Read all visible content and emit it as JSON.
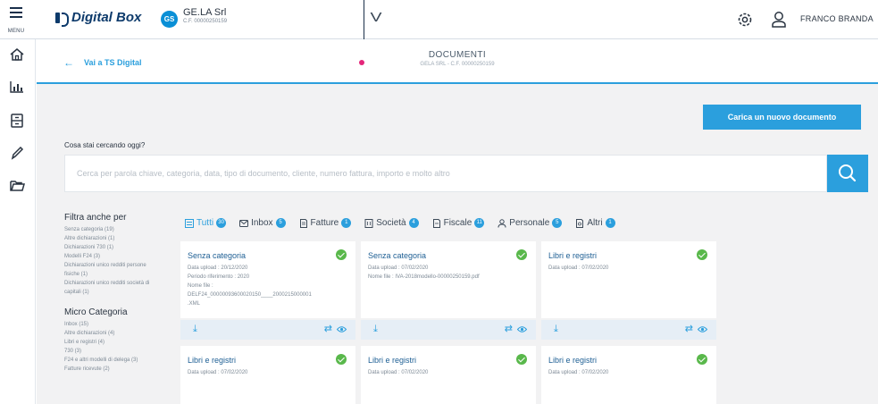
{
  "topbar": {
    "menu_label": "MENU",
    "logo_text": "Digital Box",
    "company_initials": "GS",
    "company_name": "GE.LA Srl",
    "company_cf": "C.F. 00000250159",
    "chevron": "V",
    "user_name": "FRANCO BRANDA"
  },
  "rail": {
    "items": [
      "home-icon",
      "chart-icon",
      "archive-icon",
      "pen-icon",
      "folder-icon"
    ]
  },
  "subheader": {
    "back_label": "Vai a TS Digital",
    "title": "DOCUMENTI",
    "subtitle": "GELA SRL - C.F. 00000250159"
  },
  "upload_button": "Carica un nuovo documento",
  "search": {
    "label": "Cosa stai cercando oggi?",
    "placeholder": "Cerca per parola chiave, categoria, data, tipo di documento, cliente, numero fattura, importo e molto altro",
    "value": ""
  },
  "filters": {
    "title": "Filtra anche per",
    "items": [
      "Senza categoria (19)",
      "Altre dichiarazioni (1)",
      "Dichiarazioni 730 (1)",
      "Modelli F24 (3)",
      "Dichiarazioni unico redditi persone",
      "fisiche (1)",
      "Dichiarazioni unico redditi società di",
      "capitali (1)"
    ],
    "micro_title": "Micro Categoria",
    "micro_items": [
      "Inbox (15)",
      "Altre dichiarazioni (4)",
      "Libri e registri (4)",
      "730 (3)",
      "F24 e altri modelli di delega (3)",
      "Fatture ricevute (2)"
    ]
  },
  "tabs": [
    {
      "label": "Tutti",
      "count": "30"
    },
    {
      "label": "Inbox",
      "count": "5"
    },
    {
      "label": "Fatture",
      "count": "1"
    },
    {
      "label": "Società",
      "count": "4"
    },
    {
      "label": "Fiscale",
      "count": "11"
    },
    {
      "label": "Personale",
      "count": "5"
    },
    {
      "label": "Altri",
      "count": "1"
    }
  ],
  "cards": [
    {
      "title": "Senza categoria",
      "lines": [
        "Data upload : 20/12/2020",
        "Periodo riferimento : 2020",
        "Nome file :",
        "DELF24_00000093600020150____2000215000001",
        ".XML"
      ]
    },
    {
      "title": "Senza categoria",
      "lines": [
        "Data upload : 07/02/2020",
        "Nome file : IVA-2018modello-00000250159.pdf"
      ]
    },
    {
      "title": "Libri e registri",
      "lines": [
        "Data upload : 07/02/2020"
      ]
    },
    {
      "title": "Libri e registri",
      "lines": [
        "Data upload : 07/02/2020"
      ]
    },
    {
      "title": "Libri e registri",
      "lines": [
        "Data upload : 07/02/2020"
      ]
    },
    {
      "title": "Libri e registri",
      "lines": [
        "Data upload : 07/02/2020"
      ]
    }
  ],
  "colors": {
    "accent": "#2b9fdd",
    "brand": "#0d3a6b",
    "success": "#59b84b",
    "pointer": "#e4267a"
  }
}
